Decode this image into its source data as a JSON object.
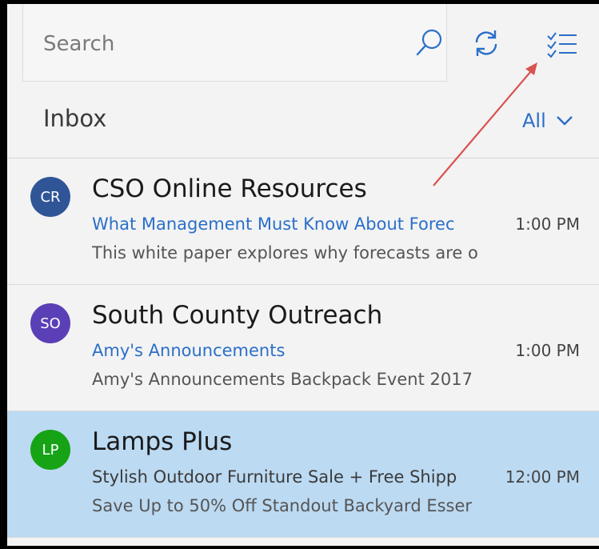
{
  "search": {
    "placeholder": "Search"
  },
  "toolbar": {
    "icons": [
      "search-icon",
      "sync-icon",
      "select-mode-icon"
    ]
  },
  "inbox": {
    "title": "Inbox",
    "filter_label": "All"
  },
  "messages": [
    {
      "initials": "CR",
      "avatar_color": "#2f5597",
      "sender": "CSO Online Resources",
      "subject": "What Management Must Know About Forec",
      "subject_color": "#2a6fc9",
      "time": "1:00 PM",
      "preview": "This white paper explores why forecasts are o",
      "selected": false
    },
    {
      "initials": "SO",
      "avatar_color": "#5b3fb6",
      "sender": "South County Outreach",
      "subject": "Amy's Announcements",
      "subject_color": "#2a6fc9",
      "time": "1:00 PM",
      "preview": "Amy's Announcements Backpack Event 2017",
      "selected": false
    },
    {
      "initials": "LP",
      "avatar_color": "#16a316",
      "sender": "Lamps Plus",
      "subject": "Stylish Outdoor Furniture Sale + Free Shipp",
      "subject_color": "#3a3a3a",
      "time": "12:00 PM",
      "preview": "Save Up to 50% Off Standout Backyard Esser",
      "selected": true
    }
  ],
  "colors": {
    "accent": "#2a6fc9",
    "selected_bg": "#bcdaf2",
    "annotation_arrow": "#d9534f"
  }
}
